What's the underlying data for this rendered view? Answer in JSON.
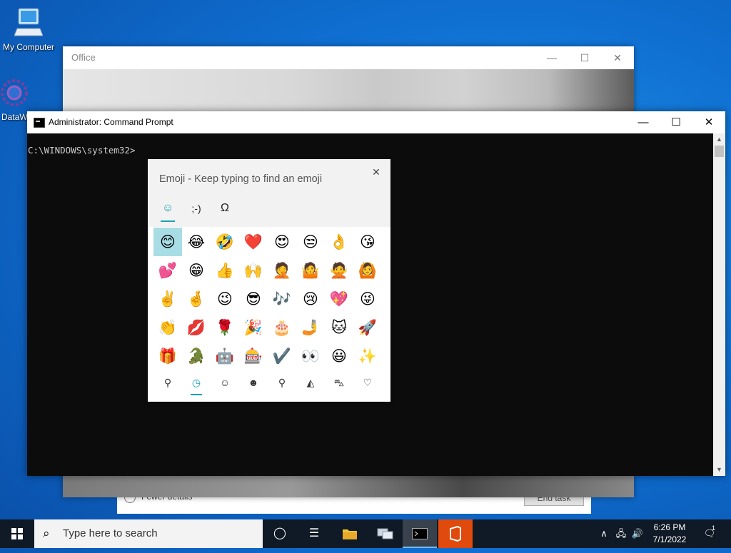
{
  "desktop": {
    "icons": [
      {
        "label": "My Computer",
        "icon": "computer-icon"
      },
      {
        "label": "DataW",
        "icon": "gear-app-icon"
      }
    ]
  },
  "task_manager": {
    "fewer_details": "Fewer details",
    "end_task": "End task"
  },
  "office_window": {
    "title": "Office"
  },
  "cmd_window": {
    "title": "Administrator: Command Prompt",
    "prompt_line": "C:\\WINDOWS\\system32>"
  },
  "emoji_panel": {
    "prompt": "Emoji - Keep typing to find an emoji",
    "close": "✕",
    "tabs": [
      {
        "label": "☺",
        "icon": "smiley-tab-icon",
        "active": true
      },
      {
        "label": ";-)",
        "icon": "kaomoji-tab-icon",
        "active": false
      },
      {
        "label": "Ω",
        "icon": "symbols-tab-icon",
        "active": false
      }
    ],
    "emojis": [
      "😊",
      "😂",
      "🤣",
      "❤️",
      "😍",
      "😒",
      "👌",
      "😘",
      "💕",
      "😁",
      "👍",
      "🙌",
      "🤦",
      "🤷",
      "🙅",
      "🙆",
      "✌️",
      "🤞",
      "😉",
      "😎",
      "🎶",
      "😢",
      "💖",
      "😜",
      "👏",
      "💋",
      "🌹",
      "🎉",
      "🎂",
      "🤳",
      "🐱",
      "🚀",
      "🎁",
      "🐊",
      "🤖",
      "🎰",
      "✔️",
      "👀",
      "😃",
      "✨"
    ],
    "selected_index": 0,
    "categories": [
      {
        "label": "⚲",
        "icon": "search-icon"
      },
      {
        "label": "◷",
        "icon": "recent-clock-icon",
        "active": true
      },
      {
        "label": "☺",
        "icon": "smiley-faces-icon"
      },
      {
        "label": "☻",
        "icon": "people-icon"
      },
      {
        "label": "⚲",
        "icon": "balloon-icon"
      },
      {
        "label": "◭",
        "icon": "pizza-icon"
      },
      {
        "label": "⛍",
        "icon": "car-icon"
      },
      {
        "label": "♡",
        "icon": "heart-icon"
      }
    ]
  },
  "taskbar": {
    "search_placeholder": "Type here to search",
    "clock_time": "6:26 PM",
    "clock_date": "7/1/2022",
    "notification_count": "1",
    "accent": "#e04a0c"
  }
}
